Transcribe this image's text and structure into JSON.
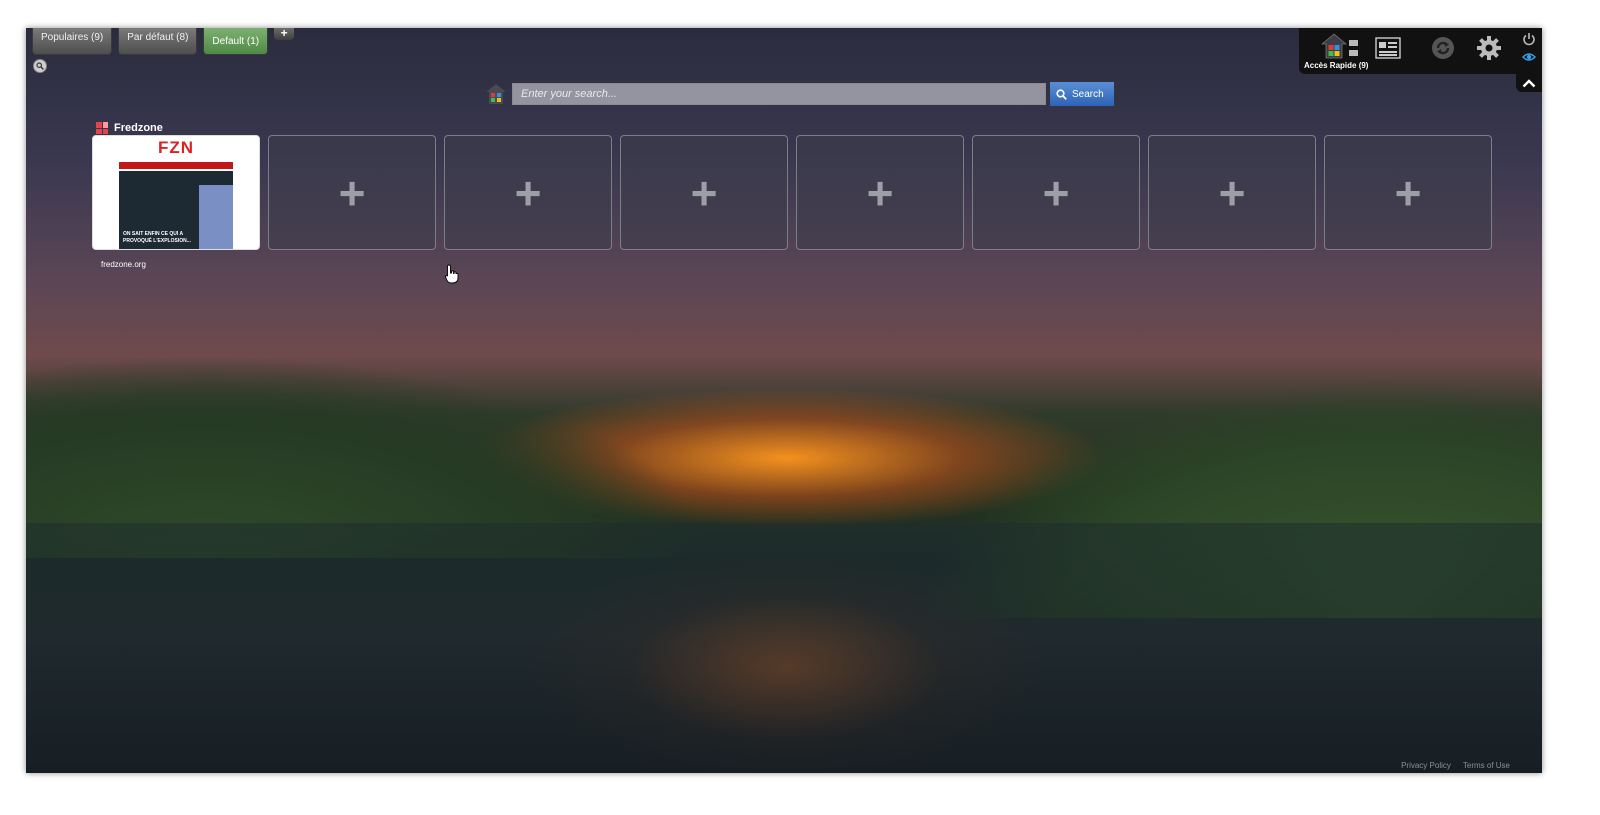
{
  "tabs": [
    {
      "label": "Populaires (9)"
    },
    {
      "label": "Par défaut (8)"
    },
    {
      "label": "Default (1)",
      "active": true
    }
  ],
  "add_tab_label": "+",
  "search": {
    "placeholder": "Enter your search...",
    "button_label": "Search"
  },
  "site": {
    "title": "Fredzone",
    "url": "fredzone.org",
    "thumb_logo": "FZN",
    "thumb_caption": "ON SAIT ENFIN CE QUI A PROVOQUÉ L'EXPLOSION..."
  },
  "empty_tiles": [
    "+",
    "+",
    "+",
    "+",
    "+",
    "+",
    "+"
  ],
  "panel": {
    "label": "Accès Rapide (9)"
  },
  "footer": {
    "privacy": "Privacy Policy",
    "terms": "Terms of Use"
  },
  "colors": {
    "active_tab": "#5e9a55",
    "search_button": "#3a72c4",
    "panel_bg": "#111111",
    "eye_icon": "#3aa0e8"
  },
  "icons": [
    "zoom-icon",
    "search-logo-icon",
    "magnifier-icon",
    "favicon-icon",
    "plus-icon",
    "cursor-hand-icon",
    "home-icon",
    "list-icon",
    "newsreader-icon",
    "refresh-icon",
    "gear-icon",
    "power-icon",
    "eye-icon",
    "chevron-up-icon"
  ]
}
